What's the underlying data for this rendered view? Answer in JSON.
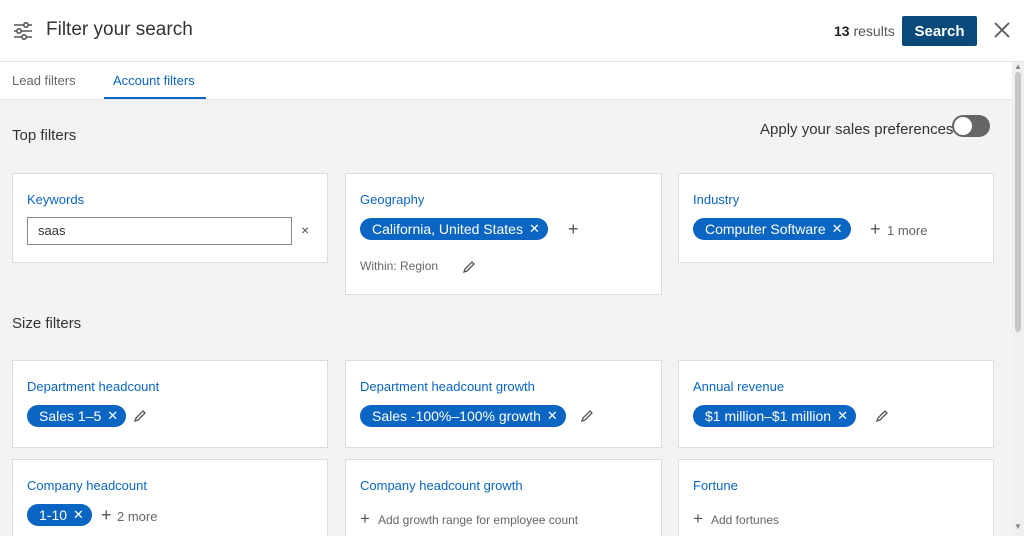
{
  "header": {
    "title": "Filter your search",
    "results_count": "13",
    "results_label": "results",
    "search_button": "Search",
    "icons": {
      "filter": "sliders-icon",
      "close": "close-icon"
    }
  },
  "tabs": [
    {
      "label": "Lead filters",
      "active": false
    },
    {
      "label": "Account filters",
      "active": true
    }
  ],
  "top_filters": {
    "title": "Top filters",
    "preferences_label": "Apply your sales preferences",
    "preferences_enabled": false,
    "keywords": {
      "label": "Keywords",
      "value": "saas",
      "clear": "×"
    },
    "geography": {
      "label": "Geography",
      "pill": "California, United States",
      "within": "Within: Region"
    },
    "industry": {
      "label": "Industry",
      "pill": "Computer Software",
      "more": "1 more"
    }
  },
  "size_filters": {
    "title": "Size filters",
    "department_headcount": {
      "label": "Department headcount",
      "pill": "Sales 1–5"
    },
    "department_headcount_growth": {
      "label": "Department headcount growth",
      "pill": "Sales -100%–100% growth"
    },
    "annual_revenue": {
      "label": "Annual revenue",
      "pill": "$1 million–$1 million"
    },
    "company_headcount": {
      "label": "Company headcount",
      "pill": "1-10",
      "more": "2 more"
    },
    "company_headcount_growth": {
      "label": "Company headcount growth",
      "add": "Add growth range for employee count"
    },
    "fortune": {
      "label": "Fortune",
      "add": "Add fortunes"
    }
  },
  "colors": {
    "primary_button": "#0a4a7a",
    "accent": "#0a66c2",
    "background": "#f3f3f3"
  }
}
